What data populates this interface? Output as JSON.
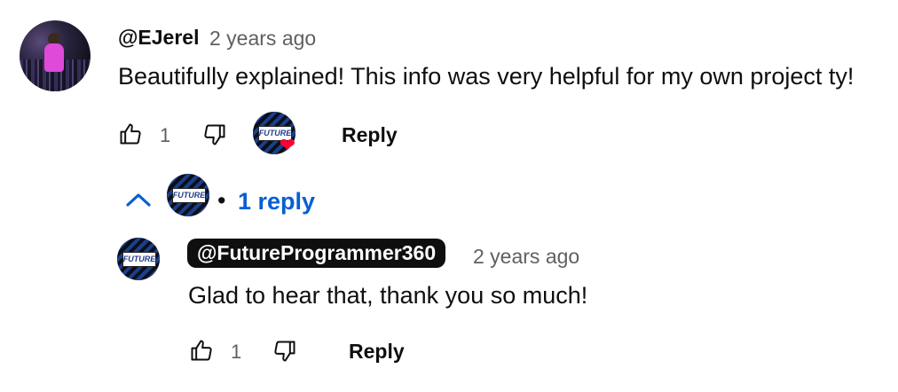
{
  "comment": {
    "author": "@EJerel",
    "time": "2 years ago",
    "text": "Beautifully explained! This info was very helpful for my own project ty!",
    "like_count": "1",
    "reply_label": "Reply"
  },
  "replies_toggle": {
    "label": "1 reply",
    "bullet": "•",
    "expanded": true
  },
  "reply": {
    "author": "@FutureProgrammer360",
    "time": "2 years ago",
    "text": "Glad to hear that, thank you so much!",
    "like_count": "1",
    "reply_label": "Reply"
  },
  "channel_avatar": {
    "logo_text": "FUTURE"
  },
  "icons": {
    "like": "thumbs-up-icon",
    "dislike": "thumbs-down-icon",
    "heart": "heart-icon",
    "collapse": "chevron-up-icon"
  },
  "colors": {
    "link_blue": "#065fd4",
    "heart_red": "#ff0033",
    "secondary_text": "#606060",
    "chip_bg": "#0f0f0f"
  }
}
